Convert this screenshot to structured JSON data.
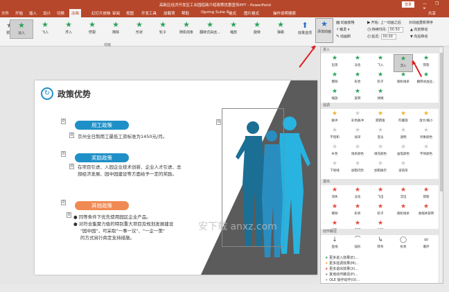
{
  "titlebar": {
    "doc_title": "高新区经济开发区工业园招商介绍政策优惠宣传PPT - PowerPoint",
    "login": "登录",
    "win_controls": "— ❐ ✕"
  },
  "tabs": [
    {
      "label": "文件"
    },
    {
      "label": "开始"
    },
    {
      "label": "插入"
    },
    {
      "label": "设计"
    },
    {
      "label": "切换"
    },
    {
      "label": "动画"
    },
    {
      "label": "幻灯片放映"
    },
    {
      "label": "审阅"
    },
    {
      "label": "视图"
    },
    {
      "label": "开发工具"
    },
    {
      "label": "加载项"
    },
    {
      "label": "帮助"
    },
    {
      "label": "iSpring Suite 8"
    },
    {
      "label": "格式"
    },
    {
      "label": "图片格式"
    },
    {
      "label": "操作说明搜索"
    }
  ],
  "share_label": "共享",
  "ribbon": {
    "preview_label": "预览",
    "gallery": [
      {
        "label": "淡入",
        "color": "#29a35a"
      },
      {
        "label": "飞入",
        "color": "#29a35a"
      },
      {
        "label": "浮入",
        "color": "#29a35a"
      },
      {
        "label": "劈裂",
        "color": "#29a35a"
      },
      {
        "label": "擦除",
        "color": "#29a35a"
      },
      {
        "label": "形状",
        "color": "#29a35a"
      },
      {
        "label": "轮子",
        "color": "#29a35a"
      },
      {
        "label": "随机线条",
        "color": "#29a35a"
      },
      {
        "label": "翻转式由远...",
        "color": "#29a35a"
      },
      {
        "label": "缩放",
        "color": "#29a35a"
      },
      {
        "label": "旋转",
        "color": "#29a35a"
      },
      {
        "label": "弹跳",
        "color": "#29a35a"
      }
    ],
    "selected_index": 0,
    "group_anim_label": "动画",
    "effect_options_label": "效果选项",
    "add_anim_label": "添加动画",
    "pane_label": "动画窗格",
    "trigger_label": "触发",
    "painter_label": "动画刷",
    "start_label": "开始:",
    "start_value": "上一动画之后",
    "duration_label": "持续时间:",
    "duration_value": "00.50",
    "delay_label": "延迟:",
    "delay_value": "00.00",
    "reorder_label": "对动画重新排序",
    "move_earlier": "▲ 向前移动",
    "move_later": "▼ 向后移动"
  },
  "slide": {
    "title": "政策优势",
    "pill1": "用工政策",
    "text1": "京州全日制用工最低工资标准为1450元/月。",
    "pill2": "奖励政策",
    "text2a": "在项目引进、入园企业技术创新、企业人才引进、总",
    "text2b": "部经济发展、园中园建设等方面给予一定的奖励。",
    "pill3": "其他政策",
    "bullet1": "同等条件下优先使用园区企业产品。",
    "bullet2a": "对符合集聚力极的特别重大项目及规划发展建设",
    "bullet2b": "\"园中园\"，可采取\"一事一议\"、\"一企一策\"",
    "bullet2c": "的方式另行商定支持措施。",
    "tag": "0",
    "watermark": "安下载 anxz.com",
    "colors": {
      "pill_blue": "#1f90c7",
      "pill_orange": "#f08a54",
      "figure_dark": "#1b6f94",
      "figure_light": "#28b3e0"
    }
  },
  "panel": {
    "sec_enter": "进入",
    "enter": [
      {
        "label": "出现",
        "color": "#29a35a"
      },
      {
        "label": "淡化",
        "color": "#29a35a"
      },
      {
        "label": "飞入",
        "color": "#29a35a"
      },
      {
        "label": "浮入",
        "color": "#29a35a"
      },
      {
        "label": "劈裂",
        "color": "#29a35a"
      },
      {
        "label": "擦除",
        "color": "#29a35a"
      },
      {
        "label": "形状",
        "color": "#29a35a"
      },
      {
        "label": "轮子",
        "color": "#29a35a"
      },
      {
        "label": "随机线条",
        "color": "#29a35a"
      },
      {
        "label": "翻转式由远...",
        "color": "#29a35a"
      },
      {
        "label": "缩放",
        "color": "#29a35a"
      },
      {
        "label": "旋转",
        "color": "#29a35a"
      },
      {
        "label": "弹跳",
        "color": "#29a35a"
      }
    ],
    "selected_enter": 3,
    "sec_emph": "强调",
    "emph": [
      {
        "label": "脉冲",
        "color": "#f2b233"
      },
      {
        "label": "彩色脉冲",
        "color": "#cccccc"
      },
      {
        "label": "跷跷板",
        "color": "#f2b233"
      },
      {
        "label": "陀螺旋",
        "color": "#f2b233"
      },
      {
        "label": "放大/缩小",
        "color": "#f2b233"
      },
      {
        "label": "不饱和",
        "color": "#cccccc"
      },
      {
        "label": "加深",
        "color": "#cccccc"
      },
      {
        "label": "变淡",
        "color": "#cccccc"
      },
      {
        "label": "透明",
        "color": "#cccccc"
      },
      {
        "label": "对象颜色",
        "color": "#cccccc"
      },
      {
        "label": "补色",
        "color": "#cccccc"
      },
      {
        "label": "线条颜色",
        "color": "#cccccc"
      },
      {
        "label": "填充颜色",
        "color": "#cccccc"
      },
      {
        "label": "画笔颜色",
        "color": "#cccccc"
      },
      {
        "label": "字体颜色",
        "color": "#cccccc"
      },
      {
        "label": "下划线",
        "color": "#cccccc"
      },
      {
        "label": "加粗闪烁",
        "color": "#cccccc"
      },
      {
        "label": "加粗展示",
        "color": "#cccccc"
      },
      {
        "label": "波浪形",
        "color": "#cccccc"
      }
    ],
    "sec_exit": "退出",
    "exit": [
      {
        "label": "消失",
        "color": "#e04a3b"
      },
      {
        "label": "淡化",
        "color": "#e04a3b"
      },
      {
        "label": "飞出",
        "color": "#e04a3b"
      },
      {
        "label": "浮出",
        "color": "#e04a3b"
      },
      {
        "label": "劈裂",
        "color": "#e04a3b"
      },
      {
        "label": "擦除",
        "color": "#e04a3b"
      },
      {
        "label": "形状",
        "color": "#e04a3b"
      },
      {
        "label": "轮子",
        "color": "#e04a3b"
      },
      {
        "label": "随机线条",
        "color": "#e04a3b"
      },
      {
        "label": "收缩并旋转",
        "color": "#e04a3b"
      },
      {
        "label": "缩放",
        "color": "#e04a3b"
      },
      {
        "label": "旋转",
        "color": "#e04a3b"
      },
      {
        "label": "弹跳",
        "color": "#e04a3b"
      }
    ],
    "sec_path": "动作路径",
    "paths": [
      {
        "label": "直线"
      },
      {
        "label": "弧形"
      },
      {
        "label": "转弯"
      },
      {
        "label": "形状"
      },
      {
        "label": "循环"
      }
    ],
    "more": [
      "更多进入效果(E)...",
      "更多强调效果(M)...",
      "更多退出效果(X)...",
      "其他动作路径(P)...",
      "OLE 操作动作(O)..."
    ]
  }
}
